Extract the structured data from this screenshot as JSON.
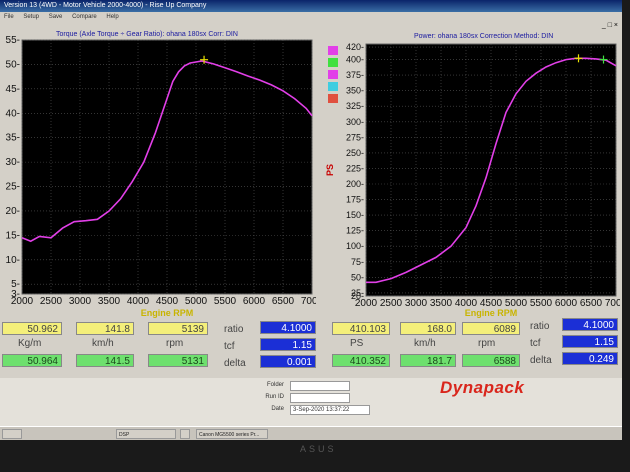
{
  "window": {
    "title": "Version 13 (4WD - Motor Vehicle 2000-4000) - Rise Up Company",
    "menu": [
      "File",
      "Setup",
      "Save",
      "Compare",
      "Help"
    ],
    "controls": "_ □ ×"
  },
  "left_chart_title": "Torque (Axle Torque ÷ Gear Ratio): ohana 180sx   Corr: DIN",
  "right_chart_title": "Power: ohana 180sx   Correction Method: DIN",
  "chart_data": [
    {
      "type": "line",
      "xlabel": "Engine RPM",
      "ylabel": "",
      "xlim": [
        2000,
        7000
      ],
      "ylim": [
        3,
        55
      ],
      "xticks": [
        2000,
        2500,
        3000,
        3500,
        4000,
        4500,
        5000,
        5500,
        6000,
        6500,
        7000
      ],
      "yticks": [
        3,
        5,
        10,
        15,
        20,
        25,
        30,
        35,
        40,
        45,
        50,
        55
      ],
      "grid": true,
      "x": [
        2000,
        2150,
        2300,
        2500,
        2700,
        2900,
        3100,
        3300,
        3500,
        3700,
        3900,
        4100,
        4300,
        4500,
        4600,
        4700,
        4800,
        4900,
        5000,
        5100,
        5300,
        5500,
        5700,
        5900,
        6100,
        6300,
        6500,
        6700,
        6900,
        7000
      ],
      "series": [
        {
          "color": "#e23fe8",
          "values": [
            14.5,
            13.8,
            14.8,
            14.5,
            16.5,
            17.8,
            18.0,
            18.3,
            20.0,
            22.5,
            26.0,
            30.0,
            36.0,
            43.0,
            46.5,
            48.5,
            49.7,
            50.3,
            50.5,
            50.7,
            50.1,
            49.3,
            48.5,
            47.6,
            46.8,
            45.8,
            44.6,
            43.0,
            41.0,
            39.5
          ]
        }
      ],
      "peak_marker": {
        "x": 5139,
        "y": 50.962
      }
    },
    {
      "type": "line",
      "xlabel": "Engine RPM",
      "ylabel": "PS",
      "xlim": [
        2000,
        7000
      ],
      "ylim": [
        20,
        425
      ],
      "xticks": [
        2000,
        2500,
        3000,
        3500,
        4000,
        4500,
        5000,
        5500,
        6000,
        6500,
        7000
      ],
      "yticks": [
        20,
        25,
        50,
        75,
        100,
        125,
        150,
        175,
        200,
        225,
        250,
        275,
        300,
        325,
        350,
        375,
        400,
        420
      ],
      "grid": true,
      "legend_swatches": [
        "#e23fe8",
        "#3fe03f",
        "#e23fe8",
        "#3fcde0",
        "#e0503f"
      ],
      "x": [
        2000,
        2200,
        2500,
        2800,
        3100,
        3400,
        3700,
        4000,
        4200,
        4400,
        4600,
        4800,
        5000,
        5200,
        5400,
        5600,
        5800,
        6000,
        6200,
        6400,
        6600,
        6800,
        7000
      ],
      "series": [
        {
          "color": "#e23fe8",
          "values": [
            42,
            42,
            48,
            58,
            70,
            82,
            100,
            130,
            165,
            210,
            265,
            315,
            345,
            365,
            378,
            388,
            395,
            400,
            402,
            402,
            401,
            399,
            390
          ]
        }
      ],
      "peak_markers": [
        {
          "x": 6250,
          "y": 402
        },
        {
          "x": 6750,
          "y": 400
        }
      ]
    }
  ],
  "readouts": {
    "left": {
      "top": [
        "50.962",
        "141.8",
        "5139"
      ],
      "units": [
        "Kg/m",
        "km/h",
        "rpm"
      ],
      "bottom": [
        "50.964",
        "141.5",
        "5131"
      ],
      "ratio_label": "ratio",
      "ratio": "4.1000",
      "tcf_label": "tcf",
      "tcf": "1.15",
      "delta_label": "delta",
      "delta": "0.001"
    },
    "right": {
      "top": [
        "410.103",
        "168.0",
        "6089"
      ],
      "units": [
        "PS",
        "km/h",
        "rpm"
      ],
      "bottom": [
        "410.352",
        "181.7",
        "6588"
      ],
      "ratio_label": "ratio",
      "ratio": "4.1000",
      "tcf_label": "tcf",
      "tcf": "1.15",
      "delta_label": "delta",
      "delta": "0.249"
    }
  },
  "info": {
    "folder_label": "Folder",
    "folder": "",
    "run_label": "Run ID",
    "run": "",
    "date_label": "Date",
    "date": "3-Sep-2020 13:37:22"
  },
  "brand": "Dynapack",
  "taskbar": [
    "",
    "DSP",
    "",
    "Canon MG5500 series Pr..."
  ],
  "bezel_brand": "ASUS"
}
